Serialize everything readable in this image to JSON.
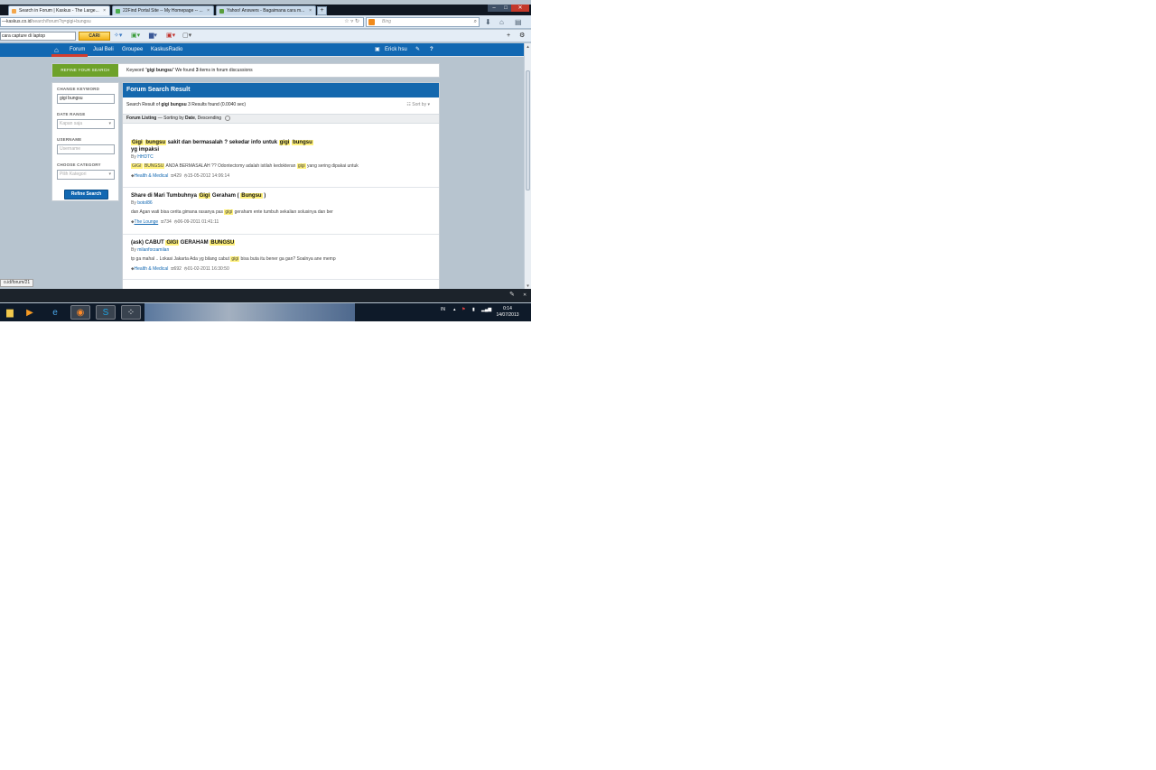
{
  "browser": {
    "tabs": [
      {
        "title": "Search in Forum | Kaskus - The Large...",
        "active": true
      },
      {
        "title": "22Find Portal Site -- My Homepage -- ...",
        "active": false
      },
      {
        "title": "Yahoo! Answers - Bagaimana cara m...",
        "active": false
      }
    ],
    "tab_close": "×",
    "new_tab": "+",
    "url_prefix": "—kaskus.co.id",
    "url_path": "/search/forum?q=gigi+bungsu",
    "search_placeholder": "Bing",
    "toolbar_input": "cara capture di laptop",
    "toolbar_button": "CARI"
  },
  "site_nav": {
    "items": [
      "Forum",
      "Jual Beli",
      "Groupee",
      "KaskusRadio"
    ],
    "user": "Erick hsu"
  },
  "search": {
    "refine_button": "REFINE YOUR SEARCH",
    "keyword_prefix": "Keyword \"",
    "keyword": "gigi bungsu",
    "keyword_mid": "\" We found ",
    "count": "3",
    "keyword_suffix": " items in forum discussions"
  },
  "filters": {
    "keyword_label": "CHANGE KEYWORD",
    "keyword_value": "gigi bungsu",
    "date_label": "DATE RANGE",
    "date_value": "Kapan saja",
    "username_label": "USERNAME",
    "username_placeholder": "Username",
    "category_label": "CHOOSE CATEGORY",
    "category_value": "Pilih Kategori",
    "submit": "Refine Search"
  },
  "results": {
    "header": "Forum Search Result",
    "summary_prefix": "Search Result of ",
    "summary_keyword": "gigi bungsu",
    "summary_suffix": " 3 Results found (0.0040 sec)",
    "sort_by": "Sort by",
    "listing_label": "Forum Listing",
    "listing_sorting": " — Sorting by ",
    "listing_field": "Date",
    "listing_order": ", Descending",
    "items": [
      {
        "title_parts": [
          {
            "t": "Gigi",
            "hl": true
          },
          {
            "t": " ",
            "hl": false
          },
          {
            "t": "bungsu",
            "hl": true
          },
          {
            "t": " sakit dan bermasalah ? sekedar info untuk ",
            "hl": false
          },
          {
            "t": "gigi",
            "hl": true
          },
          {
            "t": " ",
            "hl": false
          },
          {
            "t": "bungsu",
            "hl": true
          },
          {
            "t": " yg impaksi",
            "hl": false
          }
        ],
        "by_prefix": "By ",
        "author": "HHDTC",
        "snippet_parts": [
          {
            "t": "GIGI",
            "hl": true
          },
          {
            "t": " ",
            "hl": false
          },
          {
            "t": "BUNGSU",
            "hl": true
          },
          {
            "t": " ANDA BERMASALAH ?? Odontectomy adalah istilah kedokteran ",
            "hl": false
          },
          {
            "t": "gigi",
            "hl": true
          },
          {
            "t": " yang sering dipakai untuk",
            "hl": false
          }
        ],
        "category": "Health & Medical",
        "replies": "429",
        "date": "15-05-2012 14:06:14"
      },
      {
        "title_parts": [
          {
            "t": "Share di Mari Tumbuhnya ",
            "hl": false
          },
          {
            "t": "Gigi",
            "hl": true
          },
          {
            "t": " Geraham ( ",
            "hl": false
          },
          {
            "t": "Bungsu",
            "hl": true
          },
          {
            "t": " )",
            "hl": false
          }
        ],
        "by_prefix": "By ",
        "author": "botol86",
        "snippet_parts": [
          {
            "t": "dan Agan wati bisa cerita gimana rasanya pas ",
            "hl": false
          },
          {
            "t": "gigi",
            "hl": true
          },
          {
            "t": " geraham ente tumbuh sekalian solusinya dan ber",
            "hl": false
          }
        ],
        "category": "The Lounge",
        "replies": "734",
        "date": "06-09-2011 01:41:11"
      },
      {
        "title_parts": [
          {
            "t": "(ask) CABUT ",
            "hl": false
          },
          {
            "t": "GIGI",
            "hl": true
          },
          {
            "t": " GERAHAM ",
            "hl": false
          },
          {
            "t": "BUNGSU",
            "hl": true
          }
        ],
        "by_prefix": "By ",
        "author": "milanforzamilan",
        "snippet_parts": [
          {
            "t": "tp ga mahal .. Lokasi Jakarta Ada yg bilang cabut ",
            "hl": false
          },
          {
            "t": "gigi",
            "hl": true
          },
          {
            "t": " bisa buta itu bener ga gan? Soalnya ane memp",
            "hl": false
          }
        ],
        "category": "Health & Medical",
        "replies": "692",
        "date": "01-02-2011 16:30:50"
      }
    ]
  },
  "status_url": "o.id/forum/21",
  "tray": {
    "lang": "IN",
    "time": "0:14",
    "date": "14/07/2013"
  },
  "icons": {
    "home": "home-icon",
    "pencil": "pencil-icon",
    "help": "help-icon",
    "comment": "comment-icon",
    "clock": "clock-icon",
    "tag": "tag-icon"
  },
  "colors": {
    "kaskus_blue": "#1268b2",
    "refine_green": "#6ea22a",
    "highlight": "#fff17a"
  }
}
